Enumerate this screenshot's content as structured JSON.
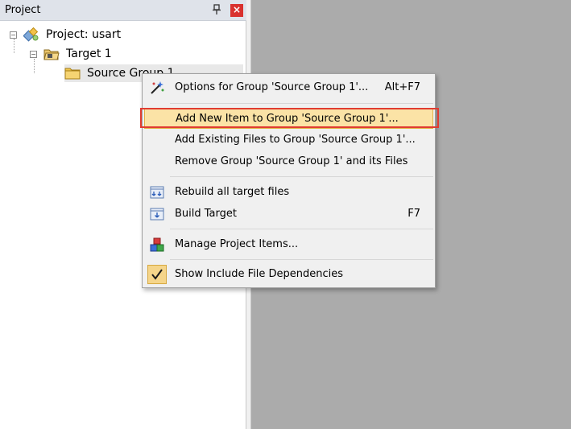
{
  "panel": {
    "title": "Project",
    "pin_glyph": "ᴘ",
    "close_glyph": "×"
  },
  "tree": {
    "project": {
      "expander": "−",
      "label": "Project: usart",
      "icon": "project-icon"
    },
    "target": {
      "expander": "−",
      "label": "Target 1",
      "icon": "folder-open-icon"
    },
    "group": {
      "label": "Source Group 1",
      "icon": "folder-icon"
    }
  },
  "menu": {
    "items": [
      {
        "label": "Options for Group 'Source Group 1'...",
        "shortcut": "Alt+F7",
        "icon": "magic-wand-icon"
      },
      {
        "label": "Add New  Item to Group 'Source Group 1'...",
        "shortcut": "",
        "icon": ""
      },
      {
        "label": "Add Existing Files to Group 'Source Group 1'...",
        "shortcut": "",
        "icon": ""
      },
      {
        "label": "Remove Group 'Source Group 1' and its Files",
        "shortcut": "",
        "icon": ""
      },
      {
        "label": "Rebuild all target files",
        "shortcut": "",
        "icon": "rebuild-icon"
      },
      {
        "label": "Build Target",
        "shortcut": "F7",
        "icon": "build-icon"
      },
      {
        "label": "Manage Project Items...",
        "shortcut": "",
        "icon": "manage-items-icon"
      },
      {
        "label": "Show Include File Dependencies",
        "shortcut": "",
        "icon": "checkmark-icon"
      }
    ]
  },
  "colors": {
    "highlight_fill": "#fbe3a6",
    "highlight_border": "#e2b245",
    "annotation_red": "#e03c31",
    "editor_bg": "#ababab"
  }
}
